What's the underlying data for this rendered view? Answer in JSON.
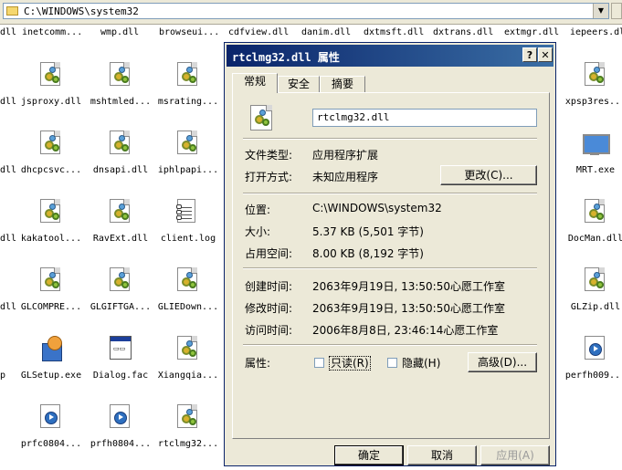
{
  "address": {
    "path": "C:\\WINDOWS\\system32"
  },
  "top_row": [
    "dll",
    "inetcomm...",
    "wmp.dll",
    "browseui...",
    "cdfview.dll",
    "danim.dll",
    "dxtmsft.dll",
    "dxtrans.dll",
    "extmgr.dll",
    "iepeers.dll"
  ],
  "files": [
    {
      "name": "jsproxy.dll",
      "icon": "dll-icon"
    },
    {
      "name": "mshtmled...",
      "icon": "dll-icon"
    },
    {
      "name": "msrating...",
      "icon": "dll-icon"
    },
    {
      "name": "dhcpcsvc...",
      "icon": "dll-icon"
    },
    {
      "name": "dnsapi.dll",
      "icon": "dll-icon"
    },
    {
      "name": "iphlpapi...",
      "icon": "dll-icon"
    },
    {
      "name": "kakatool...",
      "icon": "dll-icon"
    },
    {
      "name": "RavExt.dll",
      "icon": "dll-icon"
    },
    {
      "name": "client.log",
      "icon": "log-icon"
    },
    {
      "name": "GLCOMPRE...",
      "icon": "dll-icon"
    },
    {
      "name": "GLGIFTGA...",
      "icon": "dll-icon"
    },
    {
      "name": "GLIEDown...",
      "icon": "dll-icon"
    },
    {
      "name": "GLSetup.exe",
      "icon": "setup-icon"
    },
    {
      "name": "Dialog.fac",
      "icon": "fac-icon"
    },
    {
      "name": "Xiangqia...",
      "icon": "dll-icon"
    },
    {
      "name": "prfc0804...",
      "icon": "media-icon"
    },
    {
      "name": "prfh0804...",
      "icon": "media-icon"
    },
    {
      "name": "rtclmg32...",
      "icon": "dll-icon"
    }
  ],
  "left_edge": [
    "dll",
    "dll",
    "dll",
    "dll",
    "p"
  ],
  "right_files": [
    {
      "name": "xpsp3res...",
      "icon": "dll-icon"
    },
    {
      "name": "MRT.exe",
      "icon": "mrt-icon"
    },
    {
      "name": "DocMan.dll",
      "icon": "dll-icon"
    },
    {
      "name": "GLZip.dll",
      "icon": "dll-icon"
    },
    {
      "name": "perfh009...",
      "icon": "media-icon"
    }
  ],
  "dialog": {
    "title": "rtclmg32.dll 属性",
    "help_label": "?",
    "close_label": "✕",
    "tabs": [
      "常规",
      "安全",
      "摘要"
    ],
    "filename": "rtclmg32.dll",
    "type_label": "文件类型:",
    "type_value": "应用程序扩展",
    "open_label": "打开方式:",
    "open_value": "未知应用程序",
    "change_button": "更改(C)...",
    "location_label": "位置:",
    "location_value": "C:\\WINDOWS\\system32",
    "size_label": "大小:",
    "size_value": "5.37 KB (5,501 字节)",
    "disk_label": "占用空间:",
    "disk_value": "8.00 KB (8,192 字节)",
    "created_label": "创建时间:",
    "created_value": "2063年9月19日, 13:50:50心愿工作室",
    "modified_label": "修改时间:",
    "modified_value": "2063年9月19日, 13:50:50心愿工作室",
    "accessed_label": "访问时间:",
    "accessed_value": "2006年8月8日, 23:46:14心愿工作室",
    "attributes_label": "属性:",
    "readonly_label": "只读(R)",
    "hidden_label": "隐藏(H)",
    "advanced_button": "高级(D)...",
    "ok_button": "确定",
    "cancel_button": "取消",
    "apply_button": "应用(A)"
  }
}
